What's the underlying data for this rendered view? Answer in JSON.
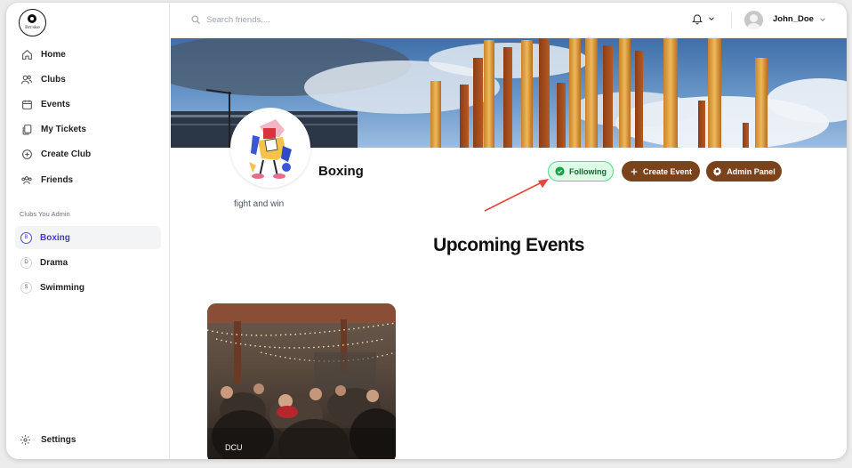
{
  "logo": {
    "wordmark": "Brrske"
  },
  "sidebar": {
    "nav": [
      {
        "label": "Home",
        "icon": "home-icon"
      },
      {
        "label": "Clubs",
        "icon": "users-icon"
      },
      {
        "label": "Events",
        "icon": "calendar-icon"
      },
      {
        "label": "My Tickets",
        "icon": "ticket-icon"
      },
      {
        "label": "Create Club",
        "icon": "plus-circle-icon"
      },
      {
        "label": "Friends",
        "icon": "friends-icon"
      }
    ],
    "section_title": "Clubs You Admin",
    "clubs": [
      {
        "initial": "B",
        "label": "Boxing",
        "active": true
      },
      {
        "initial": "D",
        "label": "Drama",
        "active": false
      },
      {
        "initial": "S",
        "label": "Swimming",
        "active": false
      }
    ],
    "settings_label": "Settings"
  },
  "header": {
    "search_placeholder": "Search friends....",
    "username": "John_Doe"
  },
  "club": {
    "name": "Boxing",
    "description": "fight and win",
    "following_label": "Following",
    "create_event_label": "Create Event",
    "admin_panel_label": "Admin Panel"
  },
  "events": {
    "heading": "Upcoming Events",
    "cards": [
      {
        "location": "DCU"
      }
    ]
  },
  "colors": {
    "accent": "#7a431c",
    "following_bg": "#dcfce7",
    "following_border": "#4ade80",
    "active_club": "#4338ca",
    "annotation_arrow": "#dc4a3a"
  }
}
